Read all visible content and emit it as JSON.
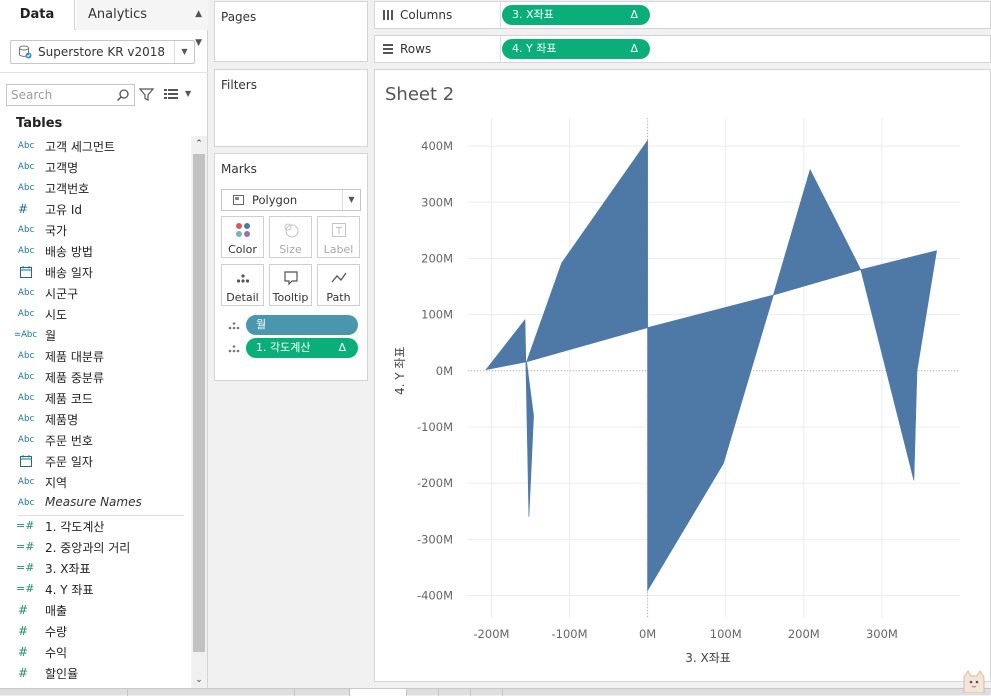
{
  "tabs": {
    "data": "Data",
    "analytics": "Analytics"
  },
  "datasource": {
    "name": "Superstore KR v2018"
  },
  "search": {
    "placeholder": "Search"
  },
  "tables_heading": "Tables",
  "fields": [
    {
      "name": "고객 세그먼트",
      "icon": "abc",
      "type": "dimension"
    },
    {
      "name": "고객명",
      "icon": "abc",
      "type": "dimension"
    },
    {
      "name": "고객번호",
      "icon": "abc",
      "type": "dimension"
    },
    {
      "name": "고유 Id",
      "icon": "hash",
      "type": "dimension"
    },
    {
      "name": "국가",
      "icon": "abc",
      "type": "dimension"
    },
    {
      "name": "배송 방법",
      "icon": "abc",
      "type": "dimension"
    },
    {
      "name": "배송 일자",
      "icon": "calendar",
      "type": "dimension"
    },
    {
      "name": "시군구",
      "icon": "abc",
      "type": "dimension"
    },
    {
      "name": "시도",
      "icon": "abc",
      "type": "dimension"
    },
    {
      "name": "월",
      "icon": "calc-abc",
      "type": "dimension"
    },
    {
      "name": "제품 대분류",
      "icon": "abc",
      "type": "dimension"
    },
    {
      "name": "제품 중분류",
      "icon": "abc",
      "type": "dimension"
    },
    {
      "name": "제품 코드",
      "icon": "abc",
      "type": "dimension"
    },
    {
      "name": "제품명",
      "icon": "abc",
      "type": "dimension"
    },
    {
      "name": "주문 번호",
      "icon": "abc",
      "type": "dimension"
    },
    {
      "name": "주문 일자",
      "icon": "calendar",
      "type": "dimension"
    },
    {
      "name": "지역",
      "icon": "abc",
      "type": "dimension"
    },
    {
      "name": "Measure Names",
      "icon": "abc",
      "type": "dimension",
      "italic": true
    },
    {
      "name": "1. 각도계산",
      "icon": "calc-hash",
      "type": "measure"
    },
    {
      "name": "2. 중앙과의 거리",
      "icon": "calc-hash",
      "type": "measure"
    },
    {
      "name": "3. X좌표",
      "icon": "calc-hash",
      "type": "measure"
    },
    {
      "name": "4. Y 좌표",
      "icon": "calc-hash",
      "type": "measure"
    },
    {
      "name": "매출",
      "icon": "hash",
      "type": "measure"
    },
    {
      "name": "수량",
      "icon": "hash",
      "type": "measure"
    },
    {
      "name": "수익",
      "icon": "hash",
      "type": "measure"
    },
    {
      "name": "할인율",
      "icon": "hash",
      "type": "measure"
    }
  ],
  "cards": {
    "pages": "Pages",
    "filters": "Filters",
    "marks": "Marks"
  },
  "marks": {
    "type": "Polygon",
    "buttons": [
      {
        "label": "Color",
        "icon": "color-icon",
        "enabled": true
      },
      {
        "label": "Size",
        "icon": "size-icon",
        "enabled": false
      },
      {
        "label": "Label",
        "icon": "label-icon",
        "enabled": false
      },
      {
        "label": "Detail",
        "icon": "detail-icon",
        "enabled": true
      },
      {
        "label": "Tooltip",
        "icon": "tooltip-icon",
        "enabled": true
      },
      {
        "label": "Path",
        "icon": "path-icon",
        "enabled": true
      }
    ],
    "pills": [
      {
        "label": "월",
        "color": "#4a96ad",
        "delta": ""
      },
      {
        "label": "1. 각도계산",
        "color": "#0aae78",
        "delta": "Δ"
      }
    ]
  },
  "shelves": {
    "columns": {
      "label": "Columns",
      "pill": "3. X좌표",
      "delta": "Δ"
    },
    "rows": {
      "label": "Rows",
      "pill": "4. Y 좌표",
      "delta": "Δ"
    }
  },
  "sheet_title": "Sheet 2",
  "chart_data": {
    "type": "polygon",
    "xlabel": "3. X좌표",
    "ylabel": "4. Y 좌표",
    "xlim": [
      -230,
      400
    ],
    "ylim": [
      -440,
      450
    ],
    "x_ticks": [
      -200,
      -100,
      0,
      100,
      200,
      300
    ],
    "x_tick_labels": [
      "-200M",
      "-100M",
      "0M",
      "100M",
      "200M",
      "300M"
    ],
    "y_ticks": [
      400,
      300,
      200,
      100,
      0,
      -100,
      -200,
      -300,
      -400
    ],
    "y_tick_labels": [
      "400M",
      "300M",
      "200M",
      "100M",
      "0M",
      "-100M",
      "-200M",
      "-300M",
      "-400M"
    ],
    "fill_color": "#4e79a7",
    "polygons": [
      {
        "name": "poly-1",
        "points": [
          [
            -207,
            2
          ],
          [
            -157,
            91
          ],
          [
            -152,
            -260
          ],
          [
            -146,
            -80
          ],
          [
            -155,
            16
          ]
        ]
      },
      {
        "name": "poly-2",
        "points": [
          [
            -155,
            16
          ],
          [
            -110,
            192
          ],
          [
            0,
            410
          ],
          [
            0,
            77
          ]
        ]
      },
      {
        "name": "poly-3",
        "points": [
          [
            0,
            77
          ],
          [
            0,
            -391
          ],
          [
            97,
            -165
          ],
          [
            161,
            135
          ]
        ]
      },
      {
        "name": "poly-4",
        "points": [
          [
            161,
            135
          ],
          [
            208,
            358
          ],
          [
            273,
            180
          ]
        ]
      },
      {
        "name": "poly-5",
        "points": [
          [
            273,
            180
          ],
          [
            370,
            214
          ],
          [
            345,
            0
          ],
          [
            341,
            -195
          ]
        ]
      }
    ]
  }
}
